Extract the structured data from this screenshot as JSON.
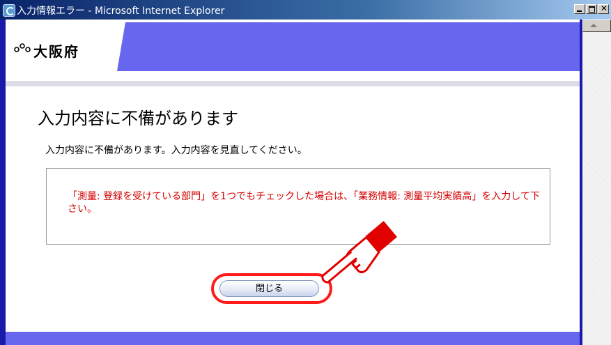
{
  "window": {
    "title": "入力情報エラー - Microsoft Internet Explorer",
    "icon": "internet-explorer-icon"
  },
  "header": {
    "logo_text": "大阪府",
    "logo_icon": "osaka-prefecture-logo-icon",
    "band_color": "#6666ee"
  },
  "main": {
    "title": "入力内容に不備があります",
    "message": "入力内容に不備があります。入力内容を見直してください。",
    "error_text": "「測量: 登録を受けている部門」を1つでもチェックした場合は、「業務情報: 測量平均実績高」を入力して下さい。",
    "error_color": "#d40000",
    "close_label": "閉じる"
  },
  "annotation": {
    "highlight_color": "#ff1a1a",
    "pointer_icon": "pointing-hand-icon"
  }
}
